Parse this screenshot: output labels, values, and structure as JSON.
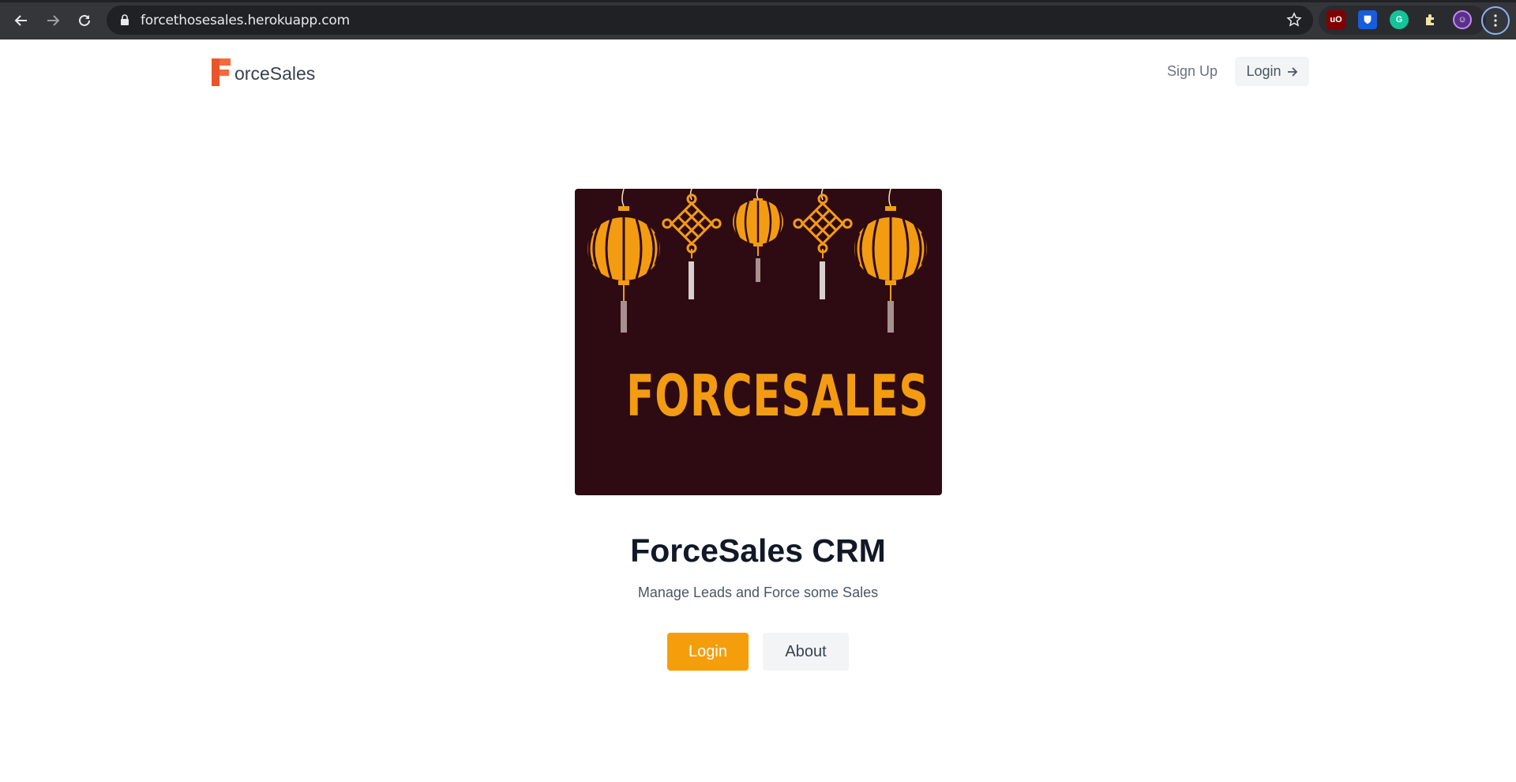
{
  "browser": {
    "url": "forcethosesales.herokuapp.com",
    "icons": [
      "back-icon",
      "forward-icon",
      "reload-icon",
      "lock-icon",
      "star-icon",
      "ublock-extension-icon",
      "bitwarden-extension-icon",
      "grammarly-extension-icon",
      "extensions-puzzle-icon",
      "profile-avatar-icon",
      "menu-kebab-icon"
    ]
  },
  "header": {
    "brand_letter": "F",
    "brand_name": "orceSales",
    "signup_label": "Sign Up",
    "login_label": "Login"
  },
  "hero": {
    "image_text": "FORCESALES",
    "title": "ForceSales CRM",
    "subtitle": "Manage Leads and Force some Sales",
    "login_button": "Login",
    "about_button": "About"
  },
  "colors": {
    "accent": "#f59e0b",
    "brand_logo": "#f26a3d",
    "hero_bg": "#2e0b12",
    "hero_text": "#f39c12"
  }
}
